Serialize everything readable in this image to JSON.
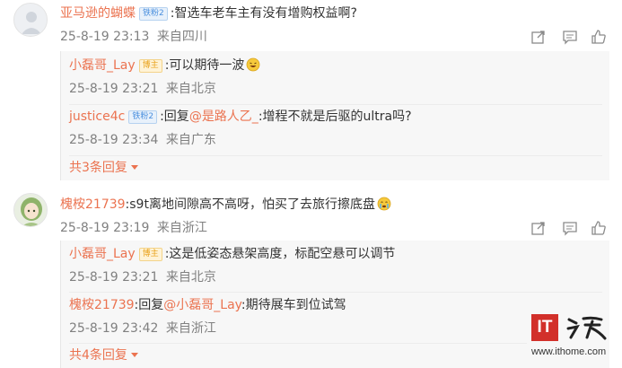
{
  "comments": [
    {
      "username": "亚马逊的蝴蝶",
      "badge": "铁粉2",
      "text": ":智选车老车主有没有增购权益啊?",
      "time": "25-8-19 23:13",
      "location": "来自四川",
      "replies": [
        {
          "username": "小磊哥_Lay",
          "badge": "博主",
          "text": ":可以期待一波",
          "emoji": "laughing-emoji",
          "time": "25-8-19 23:21",
          "location": "来自北京"
        },
        {
          "username": "justice4c",
          "badge": "铁粉2",
          "text_prefix": ":回复",
          "mention": "@是路人乙_",
          "text": ":增程不就是后驱的ultra吗?",
          "time": "25-8-19 23:34",
          "location": "来自广东"
        }
      ],
      "more_label": "共3条回复"
    },
    {
      "username": "槐桉21739",
      "text": ":s9t离地间隙高不高呀，怕买了去旅行擦底盘",
      "emoji": "crying-emoji",
      "time": "25-8-19 23:19",
      "location": "来自浙江",
      "replies": [
        {
          "username": "小磊哥_Lay",
          "badge": "博主",
          "text": ":这是低姿态悬架高度，标配空悬可以调节",
          "time": "25-8-19 23:21",
          "location": "来自北京"
        },
        {
          "username": "槐桉21739",
          "text_prefix": ":回复",
          "mention": "@小磊哥_Lay",
          "text": ":期待展车到位试驾",
          "time": "25-8-19 23:42",
          "location": "来自浙江"
        }
      ],
      "more_label": "共4条回复"
    }
  ],
  "actions": [
    "share-icon",
    "comment-icon",
    "like-icon"
  ],
  "watermark": {
    "logo": "IT",
    "url": "www.ithome.com"
  },
  "colors": {
    "name": "#eb7350",
    "meta": "#808080",
    "reply_bg": "#f7f7f7",
    "logo_red": "#d2302a"
  }
}
